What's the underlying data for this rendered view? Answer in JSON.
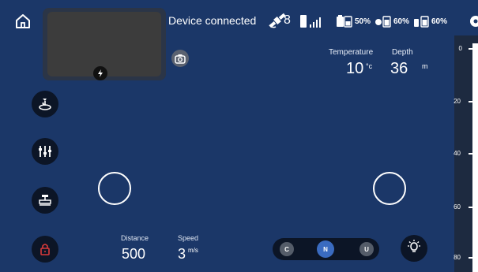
{
  "status": {
    "connection": "Device connected",
    "satellites": "8",
    "batteries": [
      {
        "value": "50%",
        "icon": "battery-remote-icon"
      },
      {
        "value": "60%",
        "icon": "battery-drone-icon"
      },
      {
        "value": "60%",
        "icon": "battery-pack-icon"
      }
    ]
  },
  "telemetry": {
    "temperature_label": "Temperature",
    "temperature_value": "10",
    "temperature_unit": "°c",
    "depth_label": "Depth",
    "depth_value": "36",
    "depth_unit": "m"
  },
  "readouts": {
    "distance_label": "Distance",
    "distance_value": "500",
    "speed_label": "Speed",
    "speed_value": "3",
    "speed_unit": "m/s"
  },
  "modes": [
    "C",
    "N",
    "U"
  ],
  "active_mode": "N",
  "depth_scale": [
    "0",
    "20",
    "40",
    "60",
    "80"
  ],
  "colors": {
    "background": "#1b3768",
    "accent": "#3a6bc0",
    "lock": "#d93a3a"
  }
}
